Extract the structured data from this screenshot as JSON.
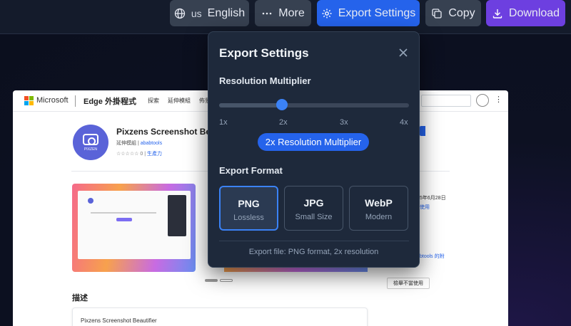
{
  "toolbar": {
    "language": {
      "code": "us",
      "label": "English",
      "icon": "globe-icon"
    },
    "more": {
      "label": "More",
      "icon": "ellipsis-icon"
    },
    "export": {
      "label": "Export Settings",
      "icon": "gear-icon"
    },
    "copy": {
      "label": "Copy",
      "icon": "copy-icon"
    },
    "download": {
      "label": "Download",
      "icon": "download-icon"
    }
  },
  "preview": {
    "brand": "Microsoft",
    "store_title": "Edge 外掛程式",
    "nav": [
      "探索",
      "延伸模組",
      "佈景"
    ],
    "product_name": "Pixzens Screenshot Bea",
    "icon_caption": "PIXZEN",
    "category": "延伸模組",
    "publisher": "ababtools",
    "rating_count": "0",
    "rating_category": "生產力",
    "date_fragment": "5年6月28日",
    "use_link": "使用",
    "publisher_link_fragment": "btools 的附",
    "report_button": "檢舉不當使用",
    "description_heading": "描述",
    "description_text": "Pixzens Screenshot Beautifier"
  },
  "export_settings": {
    "title": "Export Settings",
    "resolution": {
      "label": "Resolution Multiplier",
      "ticks": [
        "1x",
        "2x",
        "3x",
        "4x"
      ],
      "value": 2,
      "min": 1,
      "max": 4,
      "badge": "2x Resolution Multiplier"
    },
    "format": {
      "label": "Export Format",
      "options": [
        {
          "name": "PNG",
          "desc": "Lossless",
          "selected": true
        },
        {
          "name": "JPG",
          "desc": "Small Size",
          "selected": false
        },
        {
          "name": "WebP",
          "desc": "Modern",
          "selected": false
        }
      ]
    },
    "footer": "Export file: PNG format, 2x resolution"
  },
  "colors": {
    "accent": "#2563eb",
    "download": "#6d3fe0",
    "panel": "#1e293b",
    "background": "#0b0f1e"
  }
}
